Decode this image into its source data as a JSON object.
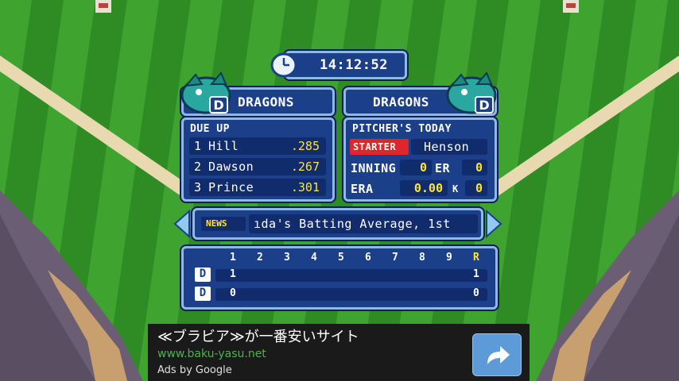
{
  "clock": {
    "time": "14:12:52",
    "icon": "clock-icon"
  },
  "teams": {
    "left": "DRAGONS",
    "right": "DRAGONS",
    "logo_icon": "dragon-logo-icon"
  },
  "due_up": {
    "title": "DUE UP",
    "batters": [
      {
        "num": "1",
        "name": "Hill",
        "avg": ".285"
      },
      {
        "num": "2",
        "name": "Dawson",
        "avg": ".267"
      },
      {
        "num": "3",
        "name": "Prince",
        "avg": ".301"
      }
    ]
  },
  "pitcher": {
    "title": "PITCHER'S TODAY",
    "starter_label": "STARTER",
    "name": "Henson",
    "inning_label": "INNING",
    "inning": "0",
    "er_label": "ER",
    "er": "0",
    "era_label": "ERA",
    "era": "0.00",
    "k_label": "K",
    "k": "0"
  },
  "news": {
    "label": "NEWS",
    "text": "ıda's Batting Average, 1st"
  },
  "scoreboard": {
    "innings": [
      "1",
      "2",
      "3",
      "4",
      "5",
      "6",
      "7",
      "8",
      "9"
    ],
    "runs_label": "R",
    "rows": [
      {
        "team": "D",
        "scores": [
          "1",
          "",
          "",
          "",
          "",
          "",
          "",
          "",
          ""
        ],
        "runs": "1"
      },
      {
        "team": "D",
        "scores": [
          "0",
          "",
          "",
          "",
          "",
          "",
          "",
          "",
          ""
        ],
        "runs": "0"
      }
    ]
  },
  "ad": {
    "title": "≪ブラビア≫が一番安いサイト",
    "url": "www.baku-yasu.net",
    "by": "Ads by Google",
    "button_icon": "share-arrow-icon"
  },
  "colors": {
    "panel": "#1c3f8a",
    "accent": "#ffe23a",
    "starter": "#e0262b",
    "ad_url": "#4cb34c"
  }
}
